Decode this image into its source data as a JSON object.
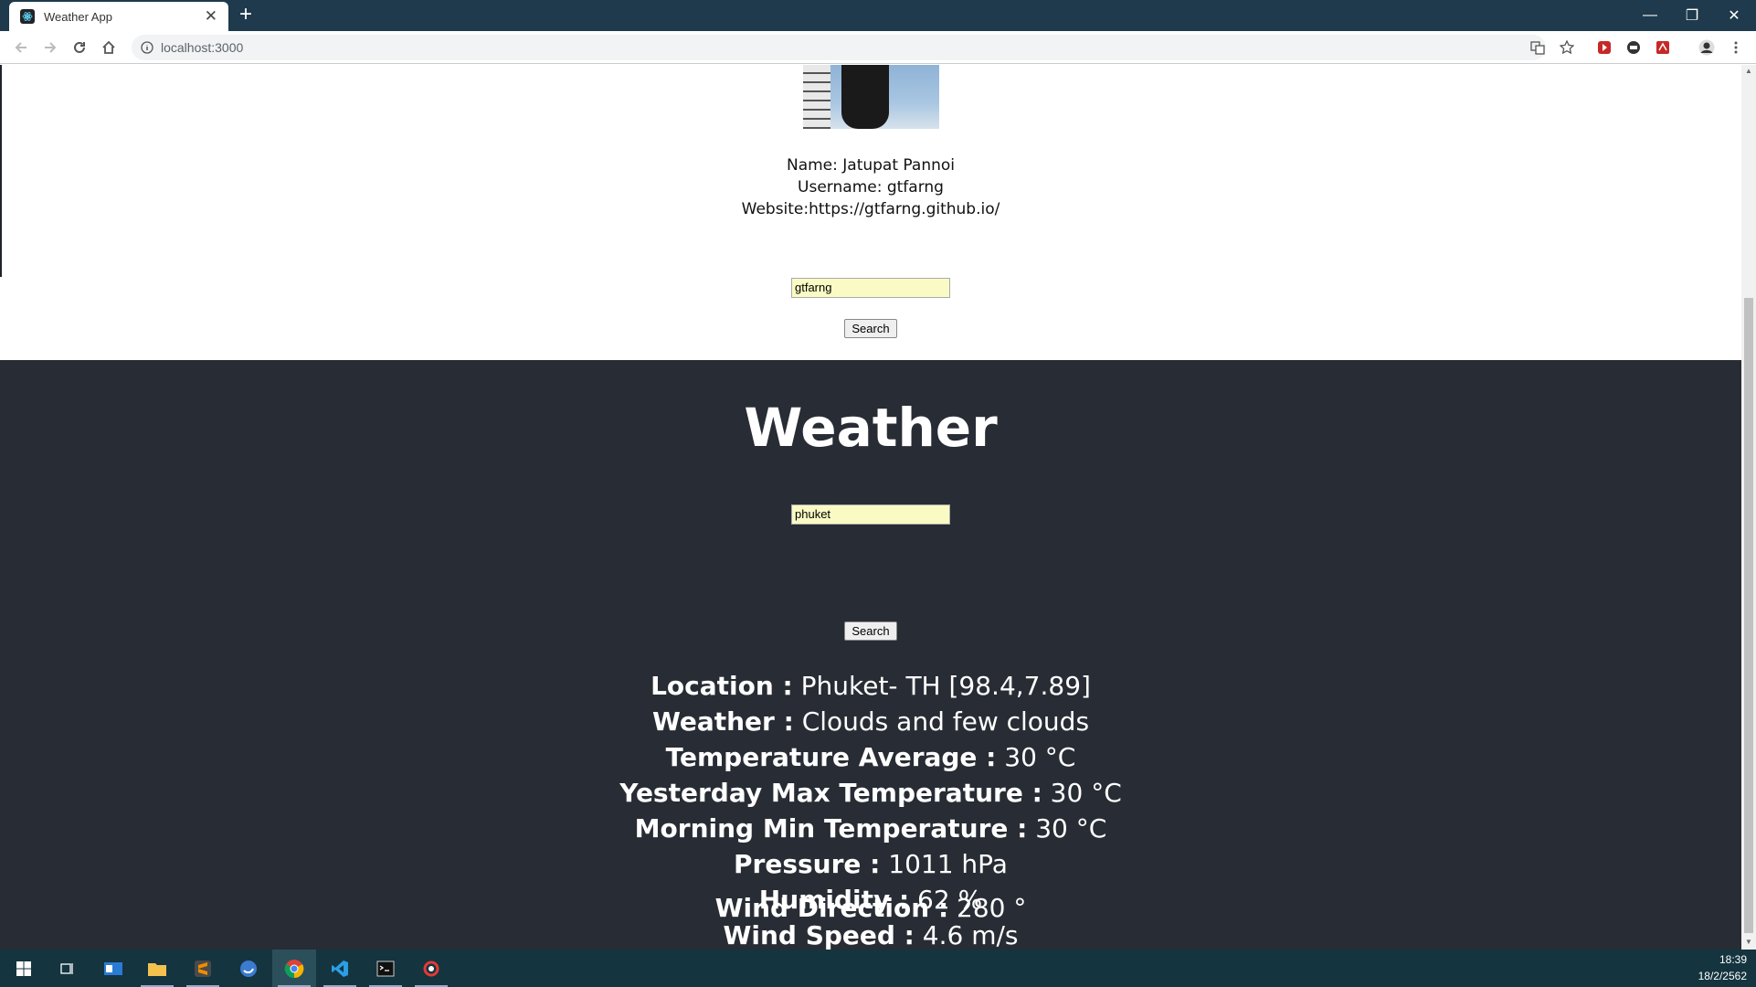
{
  "browser": {
    "tab_title": "Weather App",
    "url": "localhost:3000"
  },
  "profile": {
    "name_line": "Name: Jatupat Pannoi",
    "username_line": "Username: gtfarng",
    "website_line": "Website:https://gtfarng.github.io/",
    "search_value": "gtfarng",
    "search_button": "Search"
  },
  "weather": {
    "title": "Weather",
    "search_value": "phuket",
    "search_button": "Search",
    "rows": [
      {
        "label": "Location :",
        "value": " Phuket- TH [98.4,7.89]"
      },
      {
        "label": "Weather :",
        "value": " Clouds and few clouds"
      },
      {
        "label": "Temperature Average :",
        "value": " 30 °C"
      },
      {
        "label": "Yesterday Max Temperature :",
        "value": " 30 °C"
      },
      {
        "label": "Morning Min Temperature :",
        "value": " 30 °C"
      },
      {
        "label": "Pressure :",
        "value": " 1011 hPa"
      },
      {
        "label": "Humidity :",
        "value": " 62 %"
      },
      {
        "label": "Wind Speed :",
        "value": " 4.6 m/s"
      },
      {
        "label": "Wind Direction :",
        "value": " 280 °"
      }
    ]
  },
  "taskbar": {
    "time": "18:39",
    "date": "18/2/2562"
  },
  "colors": {
    "weather_bg": "#282c34",
    "tabbar_bg": "#1e3a4c",
    "taskbar_bg": "#14343f",
    "input_bg": "#fafac4"
  }
}
